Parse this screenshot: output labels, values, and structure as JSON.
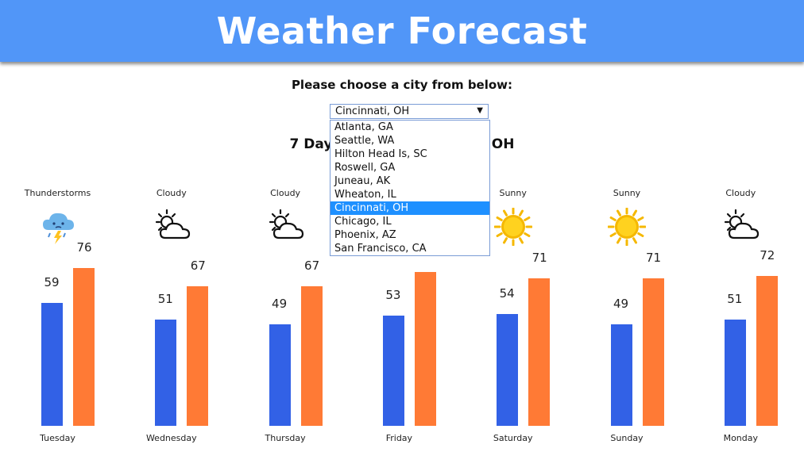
{
  "header": {
    "title": "Weather Forecast"
  },
  "city_prompt": "Please choose a city from below:",
  "city_select": {
    "selected": "Cincinnati, OH",
    "options": [
      "Atlanta, GA",
      "Seattle, WA",
      "Hilton Head Is, SC",
      "Roswell, GA",
      "Juneau, AK",
      "Wheaton, IL",
      "Cincinnati, OH",
      "Chicago, IL",
      "Phoenix, AZ",
      "San Francisco, CA"
    ],
    "selected_index": 6
  },
  "subtitle": {
    "left": "7 Day",
    "right": "ti, OH"
  },
  "colors": {
    "low": "#3261e6",
    "high": "#ff7a35",
    "header": "#5196f8"
  },
  "chart_data": {
    "type": "bar",
    "categories": [
      "Tuesday",
      "Wednesday",
      "Thursday",
      "Friday",
      "Saturday",
      "Sunday",
      "Monday"
    ],
    "conditions": [
      "Thunderstorms",
      "Cloudy",
      "Cloudy",
      "",
      "Sunny",
      "Sunny",
      "Cloudy"
    ],
    "icons": [
      "thunderstorm-icon",
      "cloudy-icon",
      "cloudy-icon",
      "",
      "sunny-icon",
      "sunny-icon",
      "cloudy-icon"
    ],
    "series": [
      {
        "values": [
          59,
          51,
          49,
          53,
          54,
          49,
          51
        ]
      },
      {
        "values": [
          76,
          67,
          67,
          74,
          71,
          71,
          72
        ]
      }
    ],
    "ylim": [
      0,
      80
    ]
  }
}
